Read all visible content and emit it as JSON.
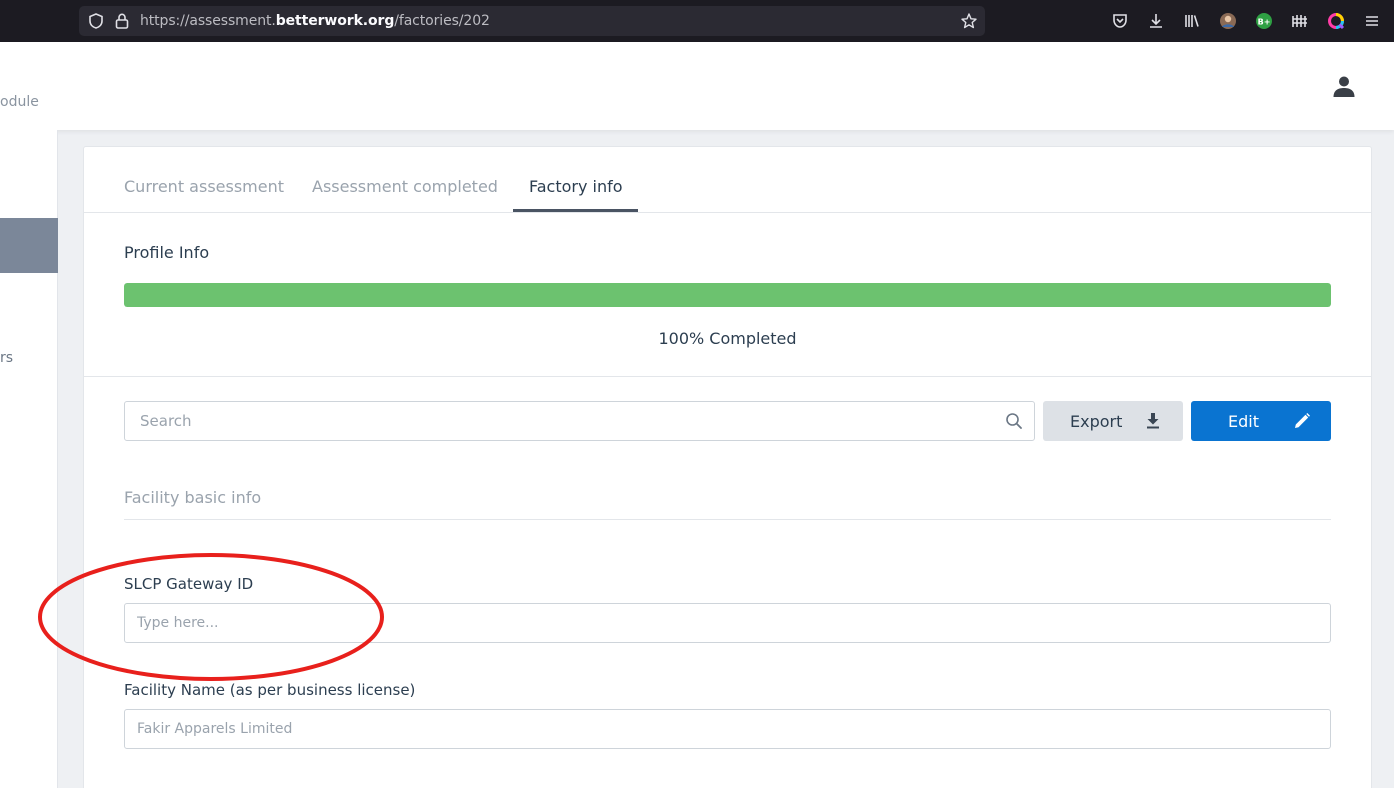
{
  "browser": {
    "url_prefix": "https://assessment.",
    "url_domain": "betterwork.org",
    "url_path": "/factories/202"
  },
  "header": {
    "module_text": "odule"
  },
  "sidebar": {
    "partial_text": "rs"
  },
  "tabs": [
    {
      "label": "Current assessment"
    },
    {
      "label": "Assessment completed"
    },
    {
      "label": "Factory info"
    }
  ],
  "profile": {
    "title": "Profile Info",
    "progress_percent": 100,
    "progress_text": "100% Completed"
  },
  "toolbar": {
    "search_placeholder": "Search",
    "export_label": "Export",
    "edit_label": "Edit"
  },
  "facility": {
    "group_title": "Facility basic info",
    "fields": [
      {
        "label": "SLCP Gateway ID",
        "placeholder": "Type here...",
        "value": ""
      },
      {
        "label": "Facility Name (as per business license)",
        "placeholder": "Fakir Apparels Limited",
        "value": ""
      }
    ]
  },
  "colors": {
    "progress": "#6cc26f",
    "primary": "#0a74d1",
    "annotation": "#e8201c"
  },
  "icons": [
    "shield-icon",
    "lock-icon",
    "star-icon",
    "pocket-icon",
    "download-icon",
    "library-icon",
    "avatar-icon",
    "bplus-icon",
    "extension-icon",
    "colorwheel-icon",
    "menu-icon",
    "user-icon",
    "search-icon",
    "download-icon",
    "pencil-icon"
  ]
}
